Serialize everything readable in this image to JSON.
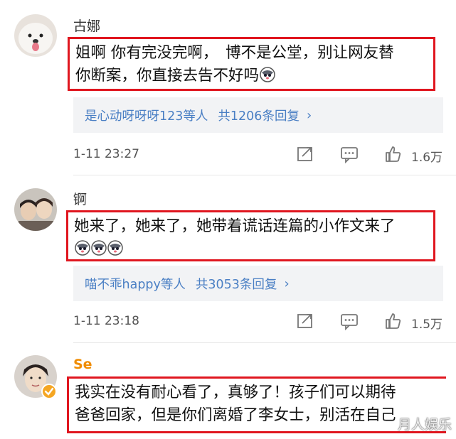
{
  "comments": [
    {
      "username": "古娜",
      "content_lines": [
        "姐啊 你有完没完啊，　博不是公堂，别让网友替",
        "你断案，你直接去告不好吗"
      ],
      "emoji_count": 1,
      "reply_preview": "是心动呀呀呀123等人",
      "reply_count": "共1206条回复",
      "timestamp": "1-11 23:27",
      "likes": "1.6万"
    },
    {
      "username": "锕",
      "content_lines": [
        "她来了，她来了，她带着谎话连篇的小作文来了",
        ""
      ],
      "emoji_count": 3,
      "reply_preview": "喵不乖happy等人",
      "reply_count": "共3053条回复",
      "timestamp": "1-11 23:18",
      "likes": "1.5万"
    },
    {
      "username": "Se",
      "content_lines": [
        "我实在没有耐心看了，真够了！孩子们可以期待",
        "爸爸回家，但是你们离婚了李女士，别活在自己"
      ]
    }
  ],
  "watermark": "月人娱乐",
  "colors": {
    "highlight": "#e0161f",
    "link": "#4a7fc4",
    "username_gold": "#f08c00"
  }
}
